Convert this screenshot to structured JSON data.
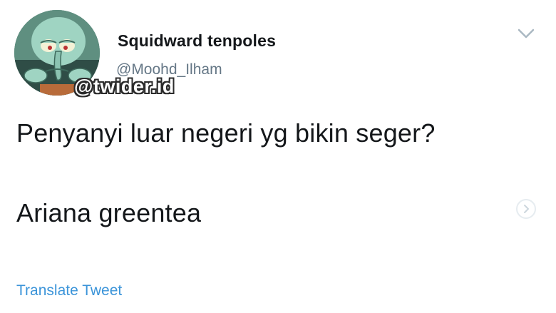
{
  "tweet": {
    "display_name": "Squidward tenpoles",
    "handle": "@Moohd_Ilham",
    "watermark": "@twider.id",
    "lines": [
      "Penyanyi luar negeri yg bikin seger?",
      "Ariana greentea"
    ],
    "translate_label": "Translate Tweet"
  },
  "icons": {
    "menu": "chevron-down-icon",
    "more": "chevron-right-icon"
  },
  "colors": {
    "link": "#3b94d9",
    "secondary_text": "#657786",
    "primary_text": "#14171a"
  }
}
